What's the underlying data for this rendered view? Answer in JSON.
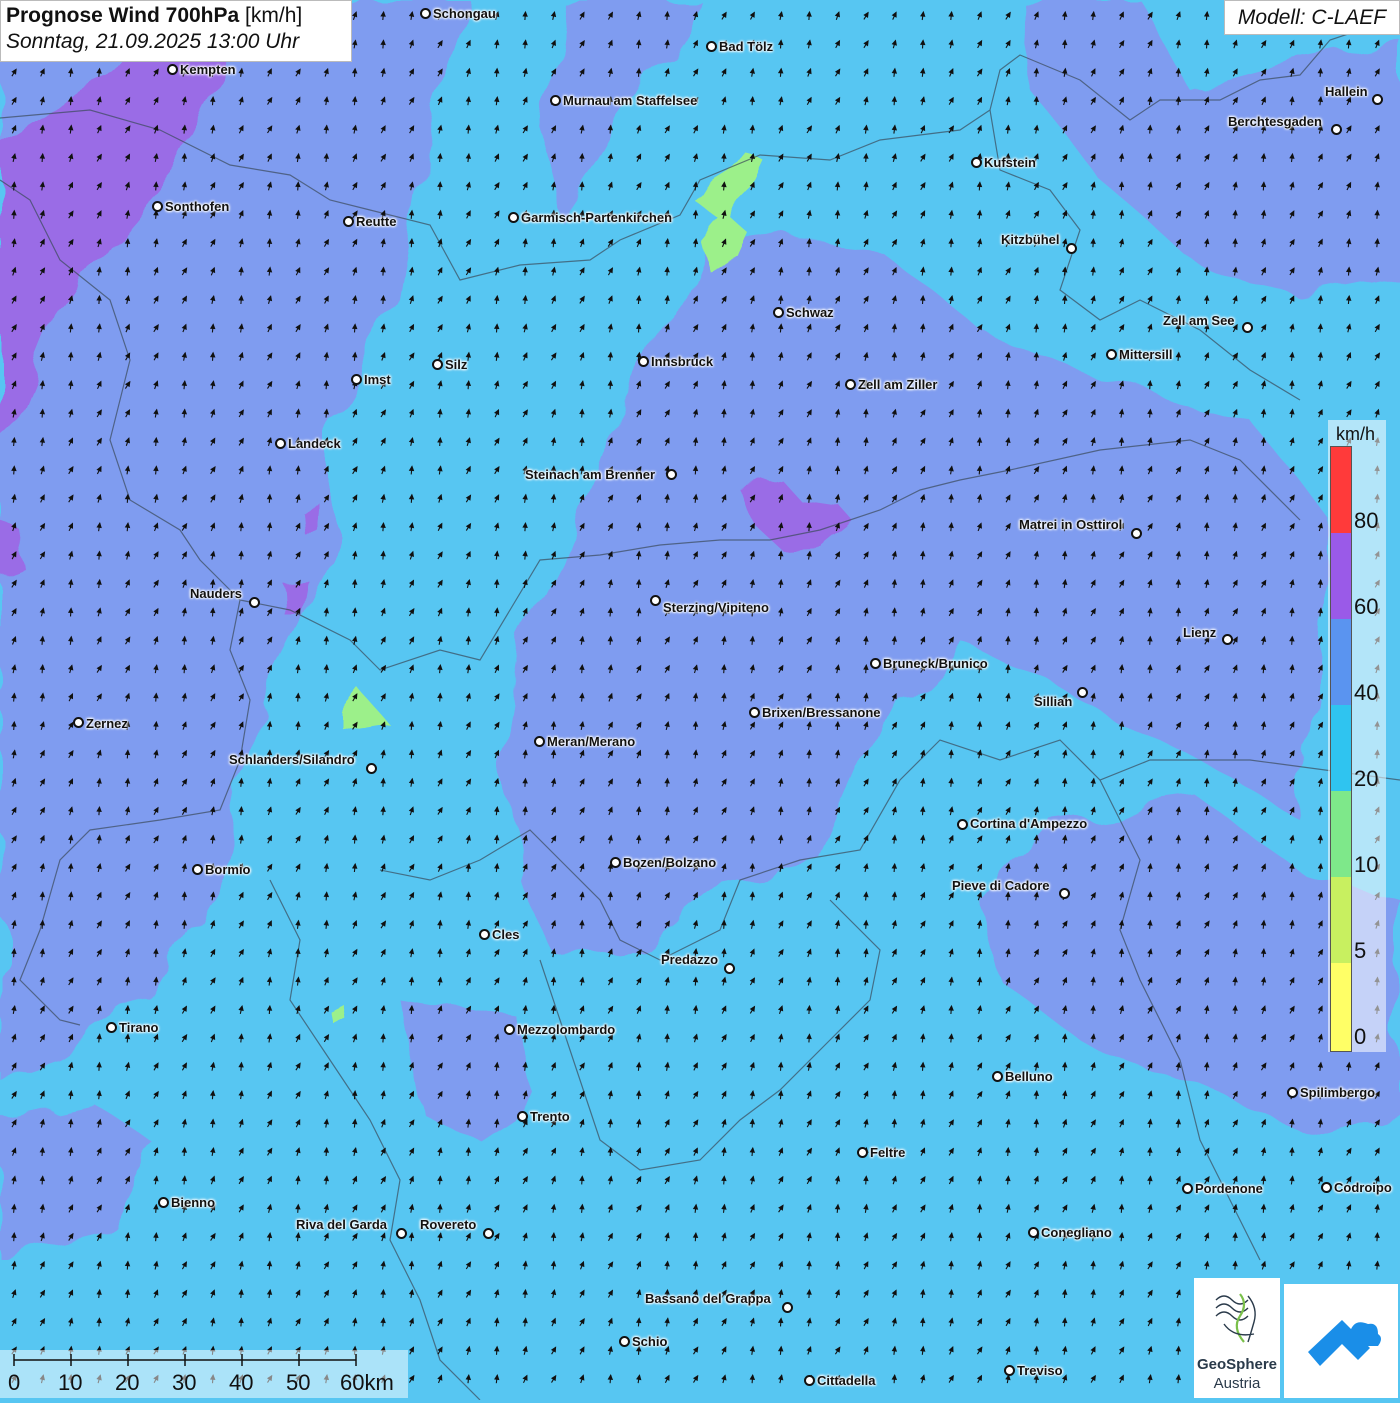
{
  "header": {
    "title_bold": "Prognose Wind 700hPa",
    "title_unit": "[km/h]",
    "subtitle": "Sonntag, 21.09.2025 13:00 Uhr",
    "model": "Modell: C-LAEF"
  },
  "legend": {
    "unit": "km/h",
    "ticks": [
      "80",
      "60",
      "40",
      "20",
      "10",
      "5",
      "0"
    ],
    "colors": [
      "#ff3a3a",
      "#9a5ae8",
      "#5a94f0",
      "#2fc4f0",
      "#7ee88a",
      "#c8f060",
      "#ffff66"
    ]
  },
  "scale_bar": {
    "labels": [
      "0",
      "10",
      "20",
      "30",
      "40",
      "50",
      "60km"
    ]
  },
  "logos": {
    "geosphere_line1": "GeoSphere",
    "geosphere_line2": "Austria",
    "geosphere_icon": "geosphere-logo-icon",
    "secondary_icon": "cloud-arrow-logo-icon"
  },
  "wind_field": {
    "predominant_direction": "southwest",
    "arrow_color": "#111111",
    "colors": {
      "base": "#57c6f2",
      "band_40_60": "#7f9cf0",
      "band_60_80": "#9a6ce6",
      "band_10_20": "#9cf08a"
    }
  },
  "cities": [
    {
      "name": "Schongau"
    },
    {
      "name": "Bad Tölz"
    },
    {
      "name": "Kempten"
    },
    {
      "name": "Murnau am Staffelsee"
    },
    {
      "name": "Hallein"
    },
    {
      "name": "Berchtesgaden"
    },
    {
      "name": "Kufstein"
    },
    {
      "name": "Sonthofen"
    },
    {
      "name": "Reutte"
    },
    {
      "name": "Garmisch-Partenkirchen"
    },
    {
      "name": "Kitzbühel"
    },
    {
      "name": "Schwaz"
    },
    {
      "name": "Zell am See"
    },
    {
      "name": "Mittersill"
    },
    {
      "name": "Innsbruck"
    },
    {
      "name": "Silz"
    },
    {
      "name": "Imst"
    },
    {
      "name": "Zell am Ziller"
    },
    {
      "name": "Landeck"
    },
    {
      "name": "Steinach am Brenner"
    },
    {
      "name": "Matrei in Osttirol"
    },
    {
      "name": "Nauders"
    },
    {
      "name": "Sterzing/Vipiteno"
    },
    {
      "name": "Lienz"
    },
    {
      "name": "Bruneck/Brunico"
    },
    {
      "name": "Sillian"
    },
    {
      "name": "Brixen/Bressanone"
    },
    {
      "name": "Zernez"
    },
    {
      "name": "Meran/Merano"
    },
    {
      "name": "Schlanders/Silandro"
    },
    {
      "name": "Cortina d'Ampezzo"
    },
    {
      "name": "Bozen/Bolzano"
    },
    {
      "name": "Bormio"
    },
    {
      "name": "Pieve di Cadore"
    },
    {
      "name": "Cles"
    },
    {
      "name": "Predazzo"
    },
    {
      "name": "Tirano"
    },
    {
      "name": "Mezzolombardo"
    },
    {
      "name": "Belluno"
    },
    {
      "name": "Spilimbergo"
    },
    {
      "name": "Trento"
    },
    {
      "name": "Feltre"
    },
    {
      "name": "Pordenone"
    },
    {
      "name": "Codroipo"
    },
    {
      "name": "Bienno"
    },
    {
      "name": "Riva del Garda"
    },
    {
      "name": "Rovereto"
    },
    {
      "name": "Conegliano"
    },
    {
      "name": "Bassano del Grappa"
    },
    {
      "name": "Schio"
    },
    {
      "name": "Treviso"
    },
    {
      "name": "Cittadella"
    }
  ]
}
